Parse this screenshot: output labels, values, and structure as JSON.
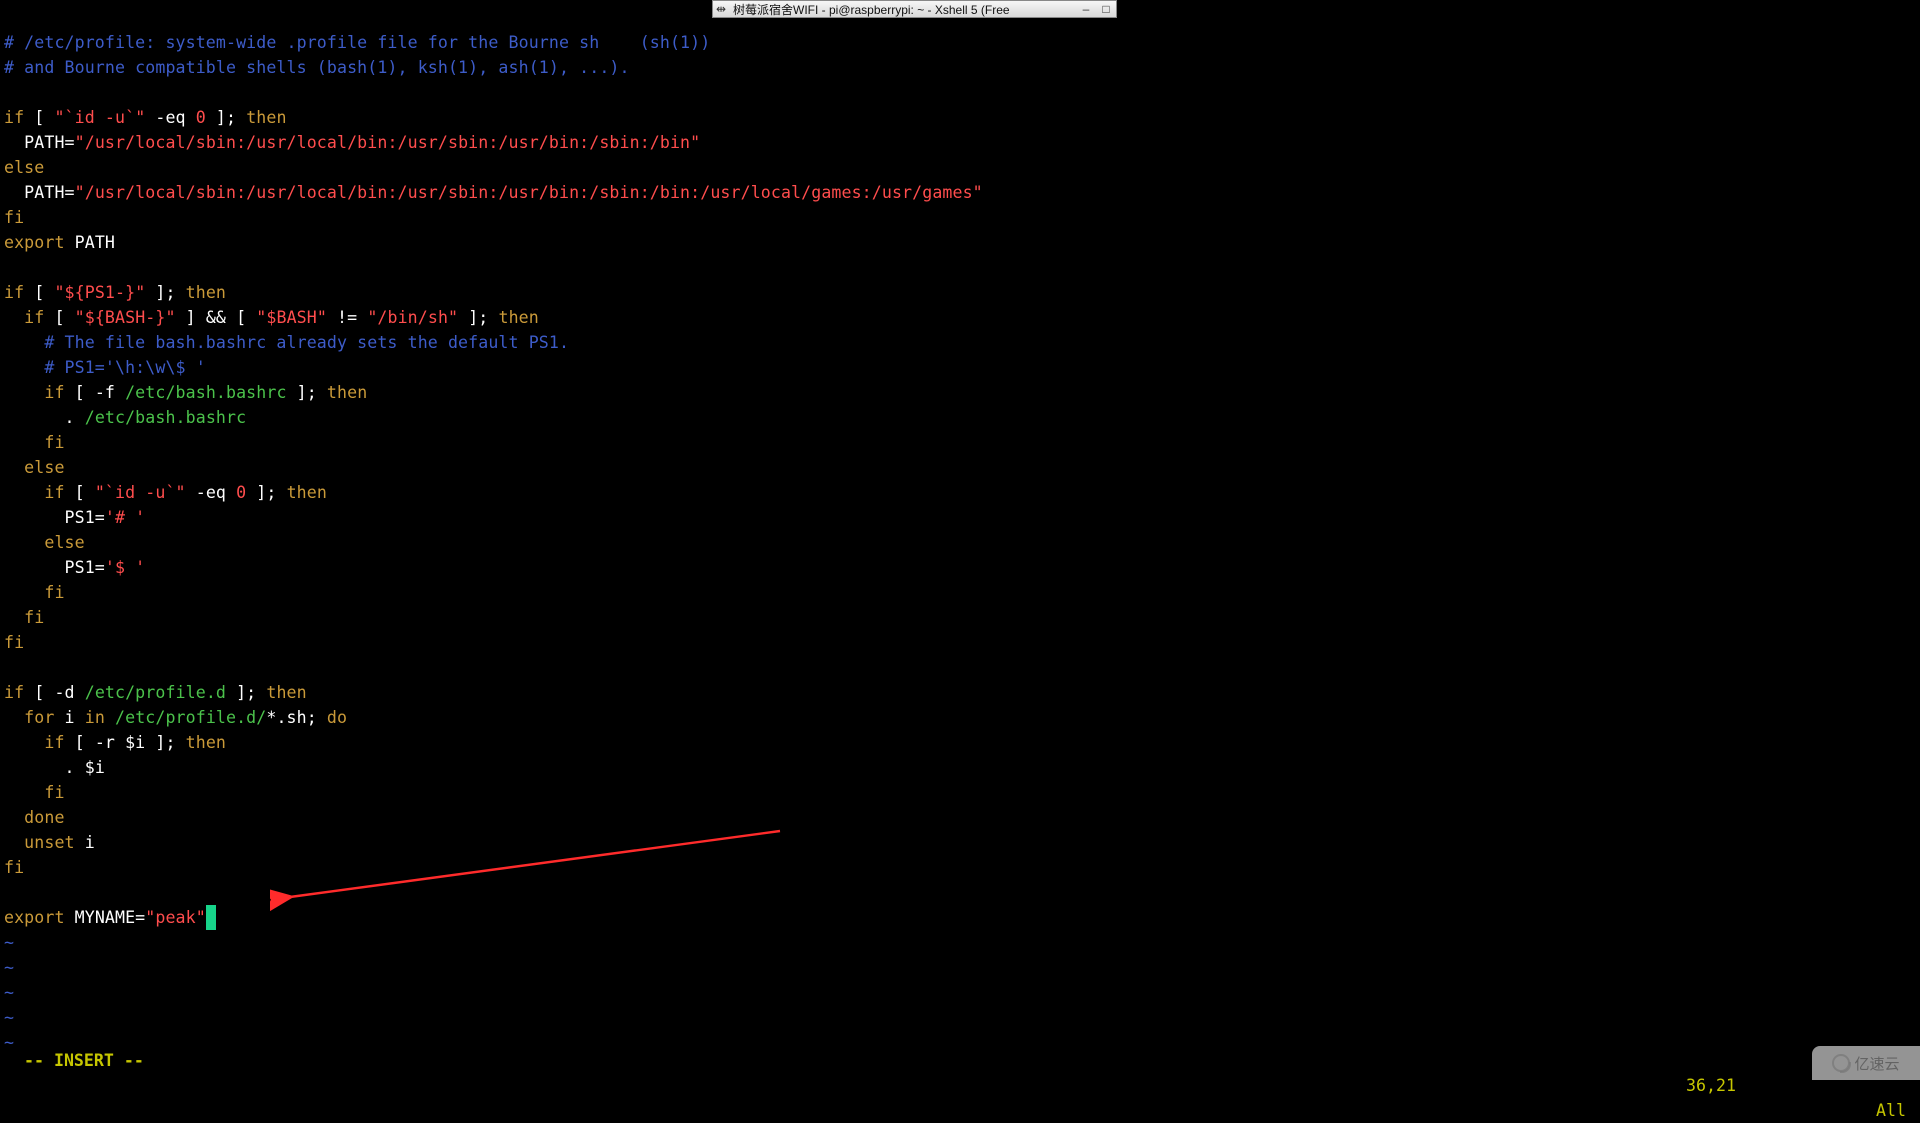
{
  "window": {
    "title": "树莓派宿舍WIFI - pi@raspberrypi: ~ - Xshell 5 (Free",
    "pin_icon": "pin-icon",
    "min_icon": "minimize-icon",
    "max_icon": "maximize-icon"
  },
  "editor": {
    "lines": {
      "l01a": "# /etc/profile: system-wide .profile file for the Bourne sh",
      "l01b": "    (sh(1))",
      "l02": "# and Bourne compatible shells (bash(1), ksh(1), ash(1), ...).",
      "l04a": "if",
      "l04b": " [ ",
      "l04c": "\"`id -u`\"",
      "l04d": " -eq ",
      "l04e": "0",
      "l04f": " ]; ",
      "l04g": "then",
      "l05a": "  PATH=",
      "l05b": "\"/usr/local/sbin:/usr/local/bin:/usr/sbin:/usr/bin:/sbin:/bin\"",
      "l06": "else",
      "l07a": "  PATH=",
      "l07b": "\"/usr/local/sbin:/usr/local/bin:/usr/sbin:/usr/bin:/sbin:/bin:/usr/local/games:/usr/games\"",
      "l08": "fi",
      "l09a": "export",
      "l09b": " PATH",
      "l11a": "if",
      "l11b": " [ ",
      "l11c": "\"${PS1-}\"",
      "l11d": " ]; ",
      "l11e": "then",
      "l12a": "  if",
      "l12b": " [ ",
      "l12c": "\"${BASH-}\"",
      "l12d": " ] && [ ",
      "l12e": "\"$BASH\"",
      "l12f": " != ",
      "l12g": "\"/bin/sh\"",
      "l12h": " ]; ",
      "l12i": "then",
      "l13": "    # The file bash.bashrc already sets the default PS1.",
      "l14": "    # PS1='\\h:\\w\\$ '",
      "l15a": "    if",
      "l15b": " [ -f ",
      "l15c": "/etc/bash.bashrc",
      "l15d": " ]; ",
      "l15e": "then",
      "l16a": "      . ",
      "l16b": "/etc/bash.bashrc",
      "l17": "    fi",
      "l18": "  else",
      "l19a": "    if",
      "l19b": " [ ",
      "l19c": "\"`id -u`\"",
      "l19d": " -eq ",
      "l19e": "0",
      "l19f": " ]; ",
      "l19g": "then",
      "l20a": "      PS1=",
      "l20b": "'# '",
      "l21": "    else",
      "l22a": "      PS1=",
      "l22b": "'$ '",
      "l23": "    fi",
      "l24": "  fi",
      "l25": "fi",
      "l27a": "if",
      "l27b": " [ -d ",
      "l27c": "/etc/profile.d",
      "l27d": " ]; ",
      "l27e": "then",
      "l28a": "  for",
      "l28b": " i ",
      "l28c": "in",
      "l28d": " /etc/profile.d/",
      "l28e": "*",
      "l28f": ".sh; ",
      "l28g": "do",
      "l29a": "    if",
      "l29b": " [ -r ",
      "l29c": "$i",
      "l29d": " ]; ",
      "l29e": "then",
      "l30a": "      . ",
      "l30b": "$i",
      "l31": "    fi",
      "l32": "  done",
      "l33a": "  unset",
      "l33b": " i",
      "l34": "fi",
      "l36a": "export",
      "l36b": " MYNAME=",
      "l36c": "\"peak\"",
      "tilde": "~"
    },
    "mode": "-- INSERT --",
    "position": "36,21",
    "scroll": "All"
  },
  "watermark": "亿速云"
}
